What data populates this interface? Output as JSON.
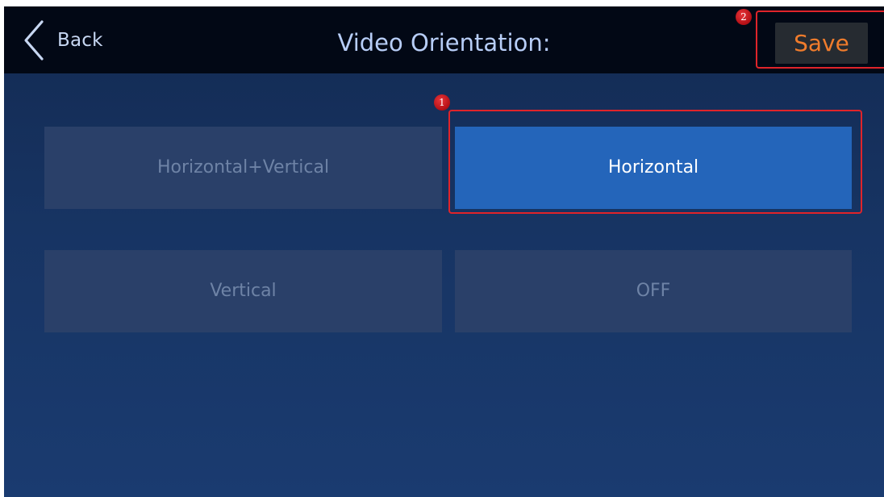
{
  "header": {
    "back_label": "Back",
    "title": "Video Orientation:",
    "save_label": "Save",
    "back_icon": "chevron-left-icon"
  },
  "options": [
    {
      "label": "Horizontal+Vertical",
      "selected": false
    },
    {
      "label": "Horizontal",
      "selected": true
    },
    {
      "label": "Vertical",
      "selected": false
    },
    {
      "label": "OFF",
      "selected": false
    }
  ],
  "annotations": {
    "step1": "1",
    "step2": "2",
    "highlight_color": "#e0242a"
  },
  "colors": {
    "accent_save": "#f07c2c",
    "selected_bg": "#2465ba",
    "unselected_bg": "#2a4069",
    "title_color": "#b7cdf7"
  }
}
